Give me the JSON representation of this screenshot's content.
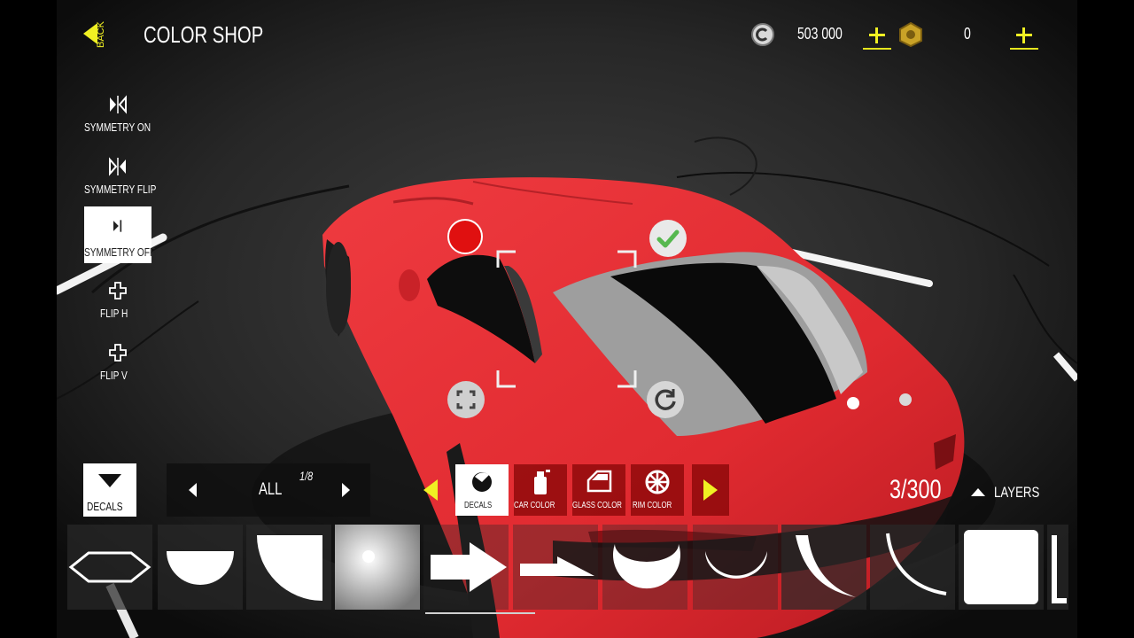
{
  "header": {
    "back_label": "BACK",
    "title": "COLOR SHOP",
    "coin_amount": "503 000",
    "gold_amount": "0",
    "accent_color": "#f0f023"
  },
  "symmetry_tools": [
    {
      "label": "SYMMETRY ON",
      "icon": "symmetry-on-icon",
      "active": false
    },
    {
      "label": "SYMMETRY FLIP",
      "icon": "symmetry-flip-icon",
      "active": false
    },
    {
      "label": "SYMMETRY OFF",
      "icon": "symmetry-off-icon",
      "active": true
    },
    {
      "label": "FLIP H",
      "icon": "flip-h-icon",
      "active": false
    },
    {
      "label": "FLIP V",
      "icon": "flip-v-icon",
      "active": false
    }
  ],
  "decals_button": {
    "label": "DECALS"
  },
  "pager": {
    "filter": "ALL",
    "page": "1/8"
  },
  "tabs": [
    {
      "label": "DECALS",
      "icon": "decal-icon",
      "active": true
    },
    {
      "label": "CAR COLOR",
      "icon": "spray-can-icon",
      "active": false
    },
    {
      "label": "GLASS COLOR",
      "icon": "car-door-icon",
      "active": false
    },
    {
      "label": "RIM COLOR",
      "icon": "rim-icon",
      "active": false
    }
  ],
  "layer_count": "3/300",
  "layers_label": "LAYERS",
  "decal_shapes": [
    "hexagon-outline",
    "half-circle",
    "quarter-circle",
    "radial-gradient",
    "arrow",
    "thin-arrow",
    "crescent",
    "arc-thin",
    "crescent-curve",
    "arc-curve",
    "square",
    "partial-frame"
  ],
  "car_color": "#e4262d",
  "decal_control_colors": {
    "delete": "#e01010",
    "confirm": "#5cb85c"
  }
}
